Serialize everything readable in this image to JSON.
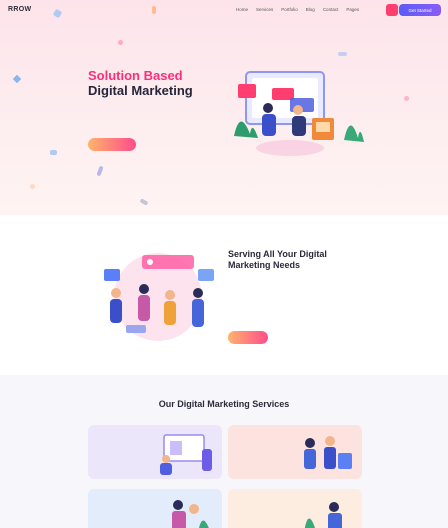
{
  "nav": {
    "logo": "RROW",
    "items": [
      "Home",
      "Services",
      "Portfolio",
      "Blog",
      "Contact",
      "Pages"
    ],
    "cta": "Get Started",
    "badge_color": "#ff3d6e",
    "cta_color": "#6a5cf6"
  },
  "hero": {
    "title_line1": "Solution Based",
    "title_line2": "Digital Marketing",
    "description": "",
    "button": ""
  },
  "serve": {
    "eyebrow": "",
    "title": "Serving All Your Digital Marketing Needs",
    "description": "",
    "button": ""
  },
  "services": {
    "eyebrow": "",
    "title": "Our Digital Marketing Services",
    "cards": [
      {
        "title": "",
        "link": "",
        "bg": "#ece6fb"
      },
      {
        "title": "",
        "link": "",
        "bg": "#fde3df"
      },
      {
        "title": "",
        "link": "",
        "bg": "#e3ecfb"
      },
      {
        "title": "",
        "link": "",
        "bg": "#fdece0"
      }
    ]
  },
  "colors": {
    "accent_pink": "#ff2d7a",
    "heading": "#26263a",
    "button_gradient_start": "#ffb36b",
    "button_gradient_end": "#ff4d8d"
  }
}
